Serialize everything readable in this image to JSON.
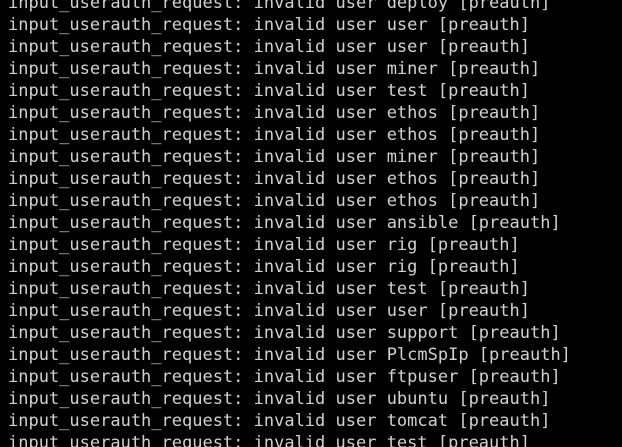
{
  "terminal": {
    "text_color": "#d2d2d2",
    "background_color": "#000000",
    "lines": [
      "input_userauth_request: invalid user deploy [preauth]",
      "input_userauth_request: invalid user user [preauth]",
      "input_userauth_request: invalid user user [preauth]",
      "input_userauth_request: invalid user miner [preauth]",
      "input_userauth_request: invalid user test [preauth]",
      "input_userauth_request: invalid user ethos [preauth]",
      "input_userauth_request: invalid user ethos [preauth]",
      "input_userauth_request: invalid user miner [preauth]",
      "input_userauth_request: invalid user ethos [preauth]",
      "input_userauth_request: invalid user ethos [preauth]",
      "input_userauth_request: invalid user ansible [preauth]",
      "input_userauth_request: invalid user rig [preauth]",
      "input_userauth_request: invalid user rig [preauth]",
      "input_userauth_request: invalid user test [preauth]",
      "input_userauth_request: invalid user user [preauth]",
      "input_userauth_request: invalid user support [preauth]",
      "input_userauth_request: invalid user PlcmSpIp [preauth]",
      "input_userauth_request: invalid user ftpuser [preauth]",
      "input_userauth_request: invalid user ubuntu [preauth]",
      "input_userauth_request: invalid user tomcat [preauth]",
      "input_userauth_request: invalid user test [preauth]"
    ]
  }
}
